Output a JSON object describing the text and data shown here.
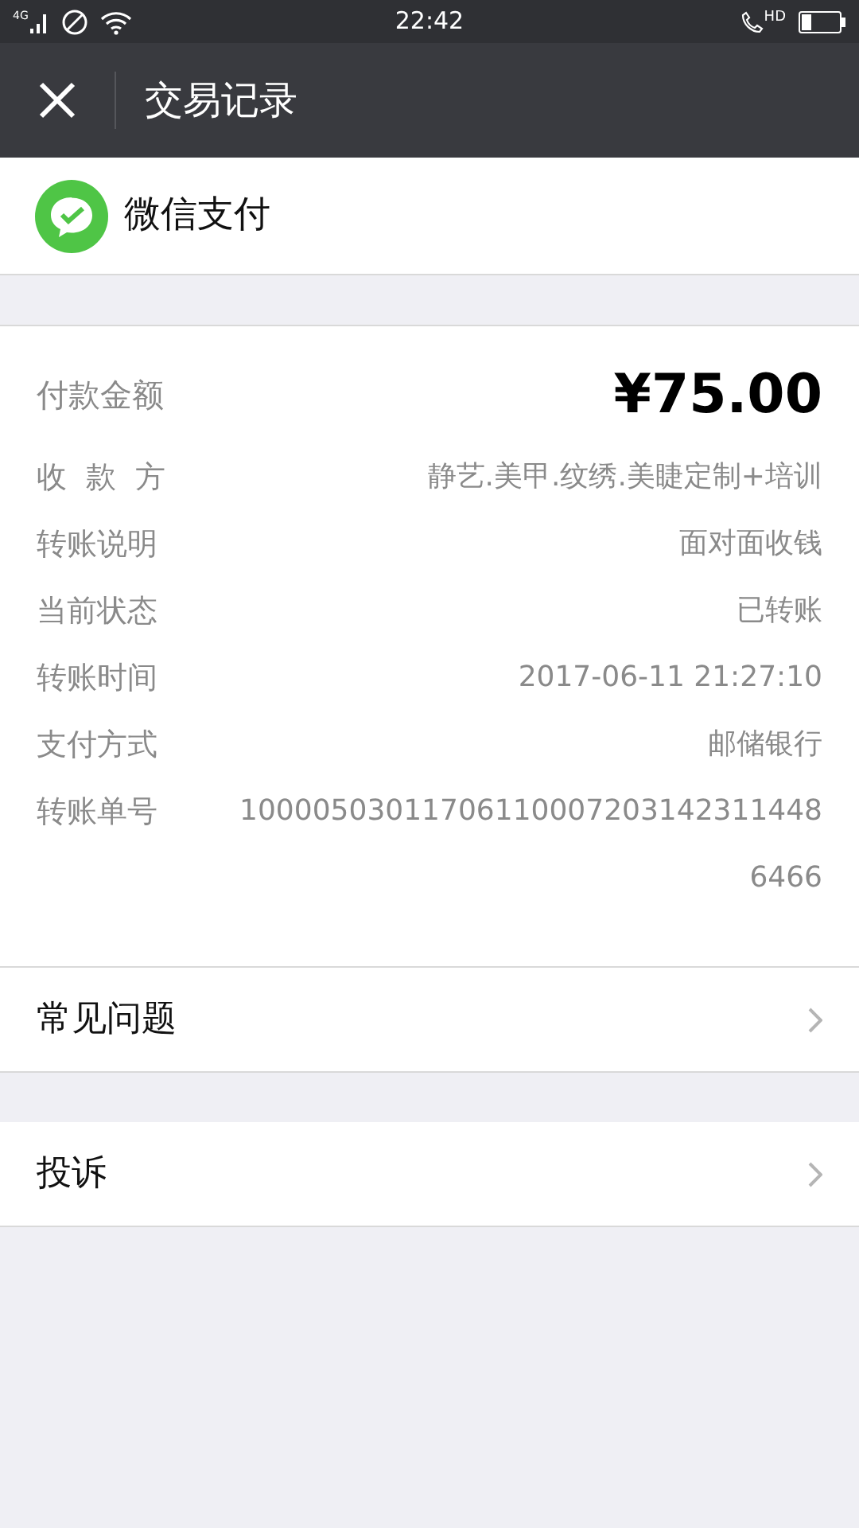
{
  "status_bar": {
    "network": "4G",
    "hd": "HD",
    "time": "22:42"
  },
  "header": {
    "title": "交易记录"
  },
  "merchant": {
    "name": "微信支付"
  },
  "amount": {
    "label": "付款金额",
    "value": "¥75.00"
  },
  "details": [
    {
      "label": "收  款  方",
      "value": "静艺.美甲.纹绣.美睫定制+培训"
    },
    {
      "label": "转账说明",
      "value": "面对面收钱"
    },
    {
      "label": "当前状态",
      "value": "已转账"
    },
    {
      "label": "转账时间",
      "value": "2017-06-11 21:27:10"
    },
    {
      "label": "支付方式",
      "value": "邮储银行"
    },
    {
      "label": "转账单号",
      "value": "100005030117061100072031423114486466"
    }
  ],
  "links": [
    {
      "label": "常见问题"
    },
    {
      "label": "投诉"
    }
  ]
}
